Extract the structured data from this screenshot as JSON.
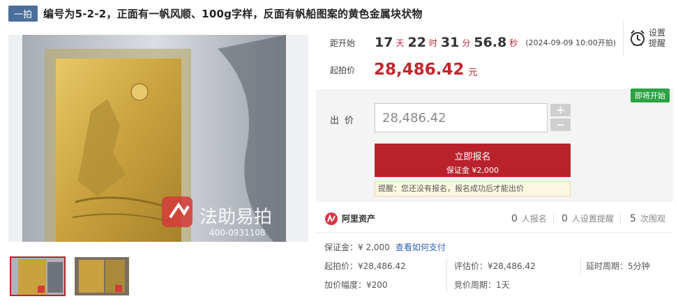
{
  "header": {
    "tag": "一拍",
    "title": "编号为5-2-2，正面有一帆风顺、100g字样，反面有帆船图案的黄色金属块状物"
  },
  "image": {
    "watermark_name": "法助易拍",
    "watermark_phone": "400-0931108"
  },
  "countdown": {
    "label": "距开始",
    "days": "17",
    "days_unit": "天",
    "hours": "22",
    "hours_unit": "时",
    "minutes": "31",
    "minutes_unit": "分",
    "seconds": "56.8",
    "seconds_unit": "秒",
    "start_note": "(2024-09-09 10:00开拍)"
  },
  "reminder": {
    "label_line1": "设置",
    "label_line2": "提醒",
    "icon": "alarm-clock-icon"
  },
  "start_price": {
    "label": "起拍价",
    "value": "28,486.42",
    "unit": "元"
  },
  "bid": {
    "status_badge": "即将开始",
    "label": "出价",
    "value": "28,486.42",
    "plus": "+",
    "minus": "−",
    "signup_button": "立即报名",
    "deposit_line": "保证金 ¥2,000",
    "tip": "提醒：您还没有报名，报名成功后才能出价"
  },
  "stats": {
    "brand": "阿里资产",
    "signups_count": "0",
    "signups_label": "人报名",
    "reminders_count": "0",
    "reminders_label": "人设置提醒",
    "views_count": "5",
    "views_label": "次围观"
  },
  "info": {
    "deposit": "保证金：¥ 2,000",
    "how_to_pay": "查看如何支付",
    "start_price": "起拍价：¥28,486.42",
    "appraisal": "评估价：¥28,486.42",
    "delay_period": "延时周期：5分钟",
    "increment": "加价幅度：¥200",
    "bid_period": "竞价周期：1天"
  },
  "colors": {
    "accent_red": "#b9222c",
    "price_red": "#c0272d",
    "status_green": "#2ca243",
    "tag_blue": "#4a6f9b",
    "link_blue": "#2e63b3"
  }
}
